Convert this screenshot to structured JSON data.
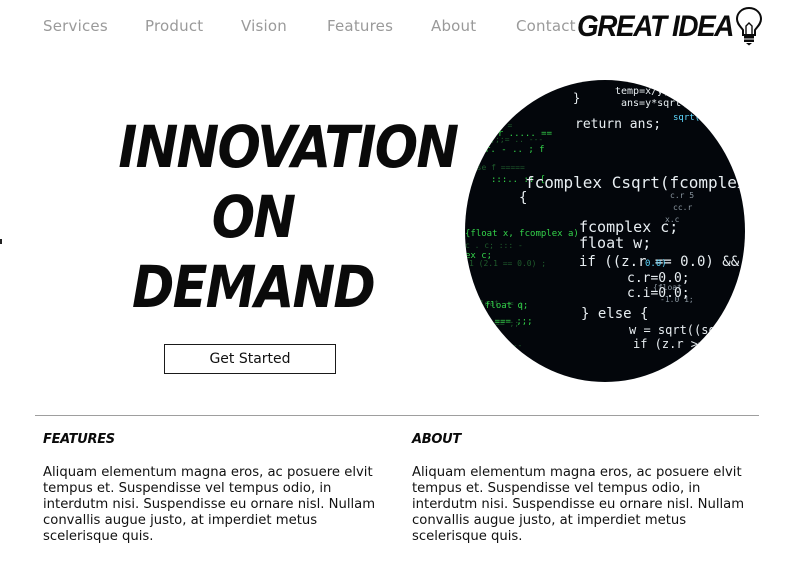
{
  "nav": {
    "items": [
      "Services",
      "Product",
      "Vision",
      "Features",
      "About",
      "Contact"
    ]
  },
  "logo": {
    "text": "GREAT IDEA",
    "icon": "lightbulb-icon"
  },
  "hero": {
    "title_lines": [
      "INNOVATION",
      "ON",
      "DEMAND"
    ],
    "cta_label": "Get Started",
    "image": "code-screen-image"
  },
  "sections": [
    {
      "heading": "FEATURES",
      "body": "Aliquam elementum magna eros, ac posuere elvit tempus et. Suspendisse vel tempus odio, in interdutm nisi. Suspendisse eu ornare nisl. Nullam convallis augue justo, at imperdiet metus scelerisque quis."
    },
    {
      "heading": "ABOUT",
      "body": "Aliquam elementum magna eros, ac posuere elvit tempus et. Suspendisse vel tempus odio, in interdutm nisi. Suspendisse eu ornare nisl. Nullam convallis augue justo, at imperdiet metus scelerisque quis."
    }
  ],
  "colors": {
    "nav_text": "#9a9a9a",
    "text": "#111111",
    "code_bg": "#03060b",
    "code_green": "#33d34a",
    "code_white": "#e8eef2"
  }
}
